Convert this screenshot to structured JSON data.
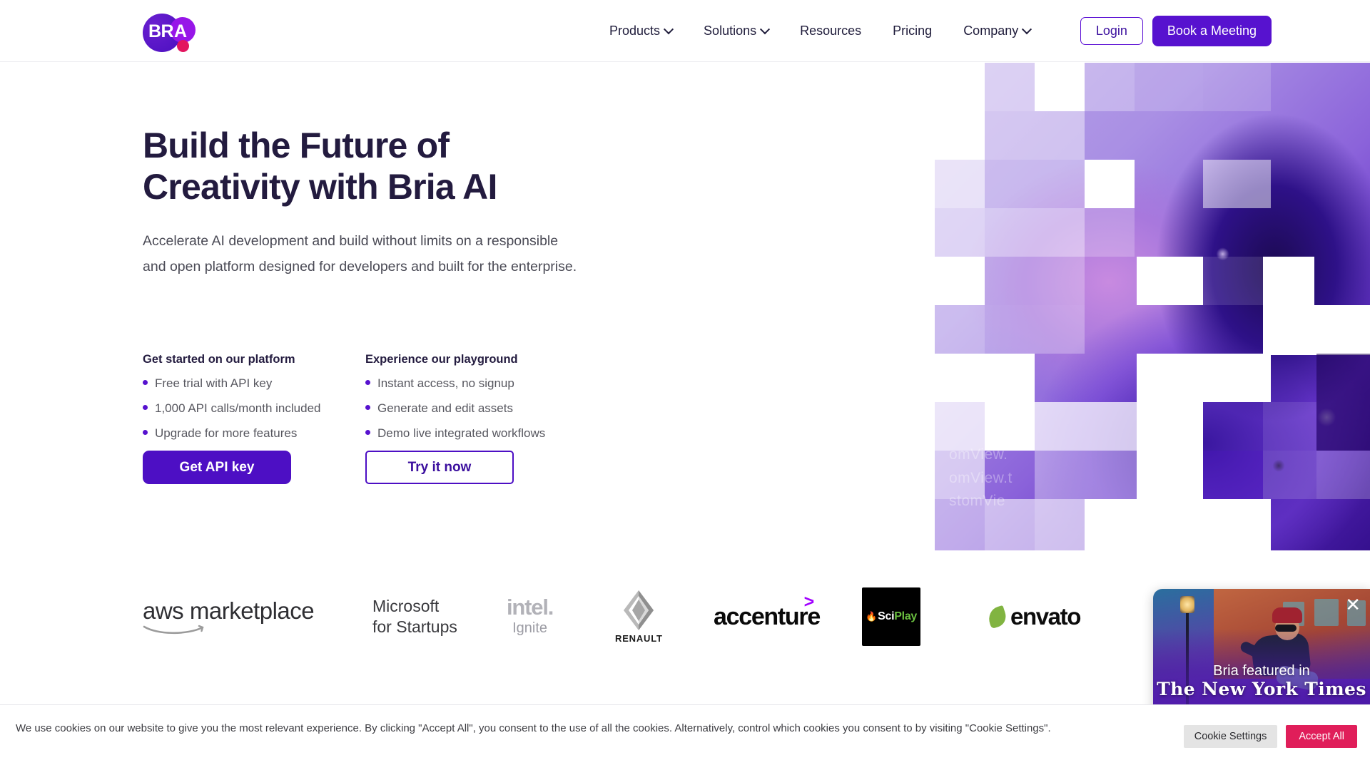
{
  "brand": {
    "logo_text": "BR",
    "logo_accent_letter": "A",
    "name": "Bria"
  },
  "nav": {
    "items": [
      {
        "label": "Products",
        "has_dropdown": true,
        "icon": "chevron-down-icon"
      },
      {
        "label": "Solutions",
        "has_dropdown": true,
        "icon": "chevron-down-icon"
      },
      {
        "label": "Resources",
        "has_dropdown": false
      },
      {
        "label": "Pricing",
        "has_dropdown": false
      },
      {
        "label": "Company",
        "has_dropdown": true,
        "icon": "chevron-down-icon"
      }
    ],
    "login_label": "Login",
    "meeting_label": "Book a Meeting"
  },
  "hero": {
    "title_line1": "Build the Future of",
    "title_line2": "Creativity with Bria AI",
    "subtitle": "Accelerate AI development and build without limits on a responsible and open platform designed for developers and built for the enterprise.",
    "columns": [
      {
        "title": "Get started on our platform",
        "items": [
          "Free trial with API key",
          "1,000 API calls/month included",
          "Upgrade for more features"
        ]
      },
      {
        "title": "Experience our playground",
        "items": [
          "Instant access, no signup",
          "Generate and edit assets",
          "Demo live integrated workflows"
        ]
      }
    ],
    "cta_primary": "Get API key",
    "cta_secondary": "Try it now",
    "art_overlay_text": "omView.\nomView.t\nstomVie"
  },
  "logos": {
    "aws": "aws marketplace",
    "aws_word1": "aws",
    "aws_word2": "marketplace",
    "microsoft_line1": "Microsoft",
    "microsoft_line2": "for Startups",
    "intel": "intel.",
    "intel_sub": "Ignite",
    "renault": "RENAULT",
    "accenture": "accenture",
    "accenture_arrow": ">",
    "sciplay_sci": "Sci",
    "sciplay_play": "Play",
    "envato": "envato"
  },
  "popup": {
    "line1": "Bria featured in",
    "line2": "The New York Times",
    "close_icon": "close-icon"
  },
  "cookie": {
    "text": "We use cookies on our website to give you the most relevant experience. By clicking \"Accept All\", you consent to the use of all the cookies. Alternatively, control which cookies you consent to by visiting \"Cookie Settings\".",
    "settings_label": "Cookie Settings",
    "accept_label": "Accept All"
  },
  "colors": {
    "brand_purple": "#5712cf",
    "deep_purple": "#4d0fc4",
    "accent_pink": "#e3155f",
    "heading": "#231b3f",
    "accept_pink": "#e01e5a"
  }
}
